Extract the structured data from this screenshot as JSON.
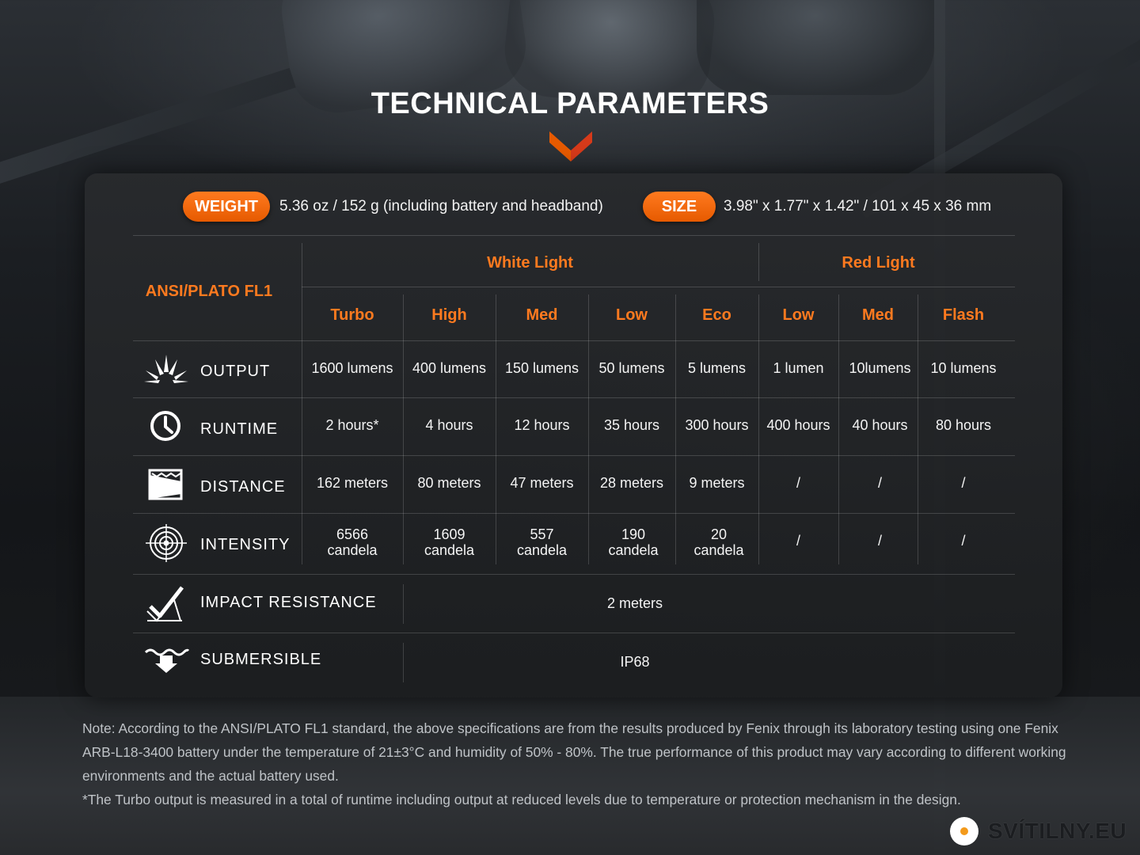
{
  "title": "TECHNICAL PARAMETERS",
  "weight": {
    "label": "WEIGHT",
    "value": "5.36 oz / 152 g (including battery and headband)"
  },
  "size": {
    "label": "SIZE",
    "value": "3.98\" x 1.77\" x 1.42\" / 101 x 45 x 36 mm"
  },
  "table": {
    "standard": "ANSI/PLATO FL1",
    "groups": {
      "white": "White Light",
      "red": "Red Light"
    },
    "modes": [
      "Turbo",
      "High",
      "Med",
      "Low",
      "Eco",
      "Low",
      "Med",
      "Flash"
    ],
    "rows": {
      "output": {
        "label": "OUTPUT",
        "icon": "burst-icon",
        "values": [
          "1600 lumens",
          "400 lumens",
          "150 lumens",
          "50 lumens",
          "5 lumens",
          "1 lumen",
          "10lumens",
          "10 lumens"
        ]
      },
      "runtime": {
        "label": "RUNTIME",
        "icon": "clock-icon",
        "values": [
          "2 hours*",
          "4 hours",
          "12 hours",
          "35 hours",
          "300 hours",
          "400 hours",
          "40 hours",
          "80 hours"
        ]
      },
      "distance": {
        "label": "DISTANCE",
        "icon": "beam-distance-icon",
        "values": [
          "162 meters",
          "80 meters",
          "47 meters",
          "28 meters",
          "9 meters",
          "/",
          "/",
          "/"
        ]
      },
      "intensity": {
        "label": "INTENSITY",
        "icon": "target-icon",
        "values": [
          [
            "6566",
            "candela"
          ],
          [
            "1609",
            "candela"
          ],
          [
            "557",
            "candela"
          ],
          [
            "190",
            "candela"
          ],
          [
            "20",
            "candela"
          ]
        ],
        "red_values": [
          "/",
          "/",
          "/"
        ]
      },
      "impact": {
        "label": "IMPACT RESISTANCE",
        "icon": "impact-check-icon",
        "value": "2 meters"
      },
      "submersible": {
        "label": "SUBMERSIBLE",
        "icon": "submersible-icon",
        "value": "IP68"
      }
    }
  },
  "note": {
    "line1": "Note: According to the ANSI/PLATO FL1 standard, the above specifications are from the results produced by Fenix through its laboratory testing using one Fenix ARB-L18-3400 battery under the temperature of 21±3°C and humidity of 50% - 80%. The true performance of this product may vary according to different working environments and the actual battery used.",
    "line2": "*The Turbo output is measured in a total of runtime including output at reduced levels due to temperature or protection mechanism in the design."
  },
  "brand": {
    "text": "SVÍTILNY.EU",
    "icon": "svitilny-logo-icon"
  },
  "colors": {
    "accent": "#ff7a1f",
    "text": "#ffffff",
    "panel": "#26282b"
  }
}
